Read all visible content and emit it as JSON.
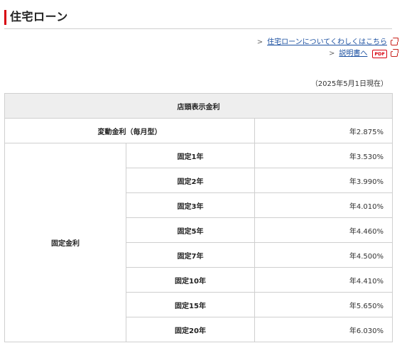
{
  "page": {
    "title": "住宅ローン"
  },
  "links": [
    {
      "label": "住宅ローンについてくわしくはこちら",
      "icon": "external-window-icon",
      "chevron": ">"
    },
    {
      "label": "説明書へ",
      "badge": "PDF",
      "icon": "external-window-icon",
      "chevron": ">"
    }
  ],
  "date_note": "（2025年5月1日現在）",
  "table": {
    "header": "店頭表示金利",
    "variable": {
      "label": "変動金利（毎月型）",
      "value": "年2.875%"
    },
    "fixed_group_label": "固定金利",
    "fixed": [
      {
        "label": "固定1年",
        "value": "年3.530%"
      },
      {
        "label": "固定2年",
        "value": "年3.990%"
      },
      {
        "label": "固定3年",
        "value": "年4.010%"
      },
      {
        "label": "固定5年",
        "value": "年4.460%"
      },
      {
        "label": "固定7年",
        "value": "年4.500%"
      },
      {
        "label": "固定10年",
        "value": "年4.410%"
      },
      {
        "label": "固定15年",
        "value": "年5.650%"
      },
      {
        "label": "固定20年",
        "value": "年6.030%"
      }
    ]
  },
  "colors": {
    "accent_bar": "#d7000f",
    "link": "#1a4fa0",
    "header_bg": "#eeeeee",
    "border": "#cfcfcf"
  }
}
